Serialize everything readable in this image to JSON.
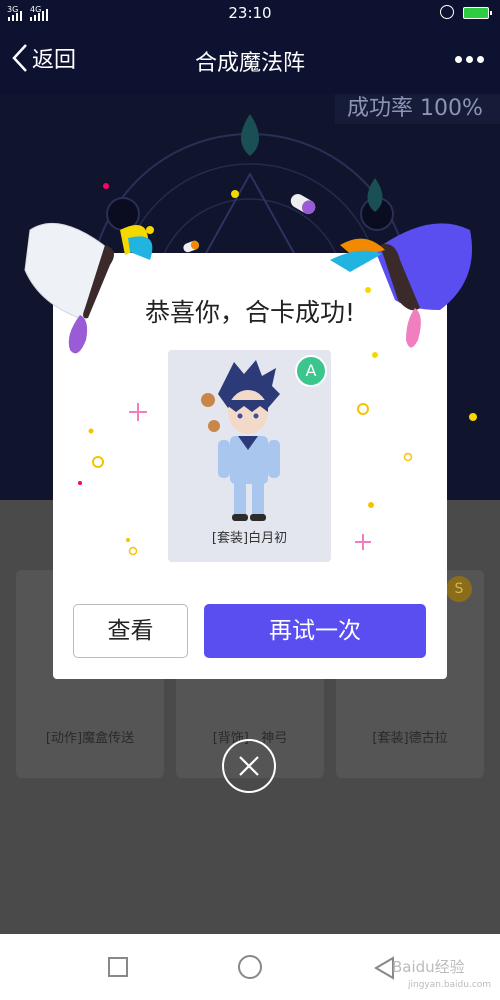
{
  "status_bar": {
    "time": "23:10",
    "signal1": "3G",
    "signal2": "4G"
  },
  "header": {
    "back_label": "返回",
    "title": "合成魔法阵"
  },
  "success_rate": "成功率 100%",
  "background_cards": [
    {
      "label": "[动作]魔盒传送"
    },
    {
      "label": "[背饰]...神弓"
    },
    {
      "label": "[套装]德古拉"
    }
  ],
  "background_card_badge": "S",
  "dialog": {
    "title": "恭喜你，合卡成功!",
    "grade_badge": "A",
    "prize_name": "[套装]白月初",
    "view_button": "查看",
    "retry_button": "再试一次"
  },
  "watermark": {
    "text": "Baidu经验",
    "url": "jingyan.baidu.com"
  },
  "colors": {
    "primary": "#5a4ef0",
    "badge_green": "#3cc58c",
    "dark_bg": "#10142d"
  }
}
